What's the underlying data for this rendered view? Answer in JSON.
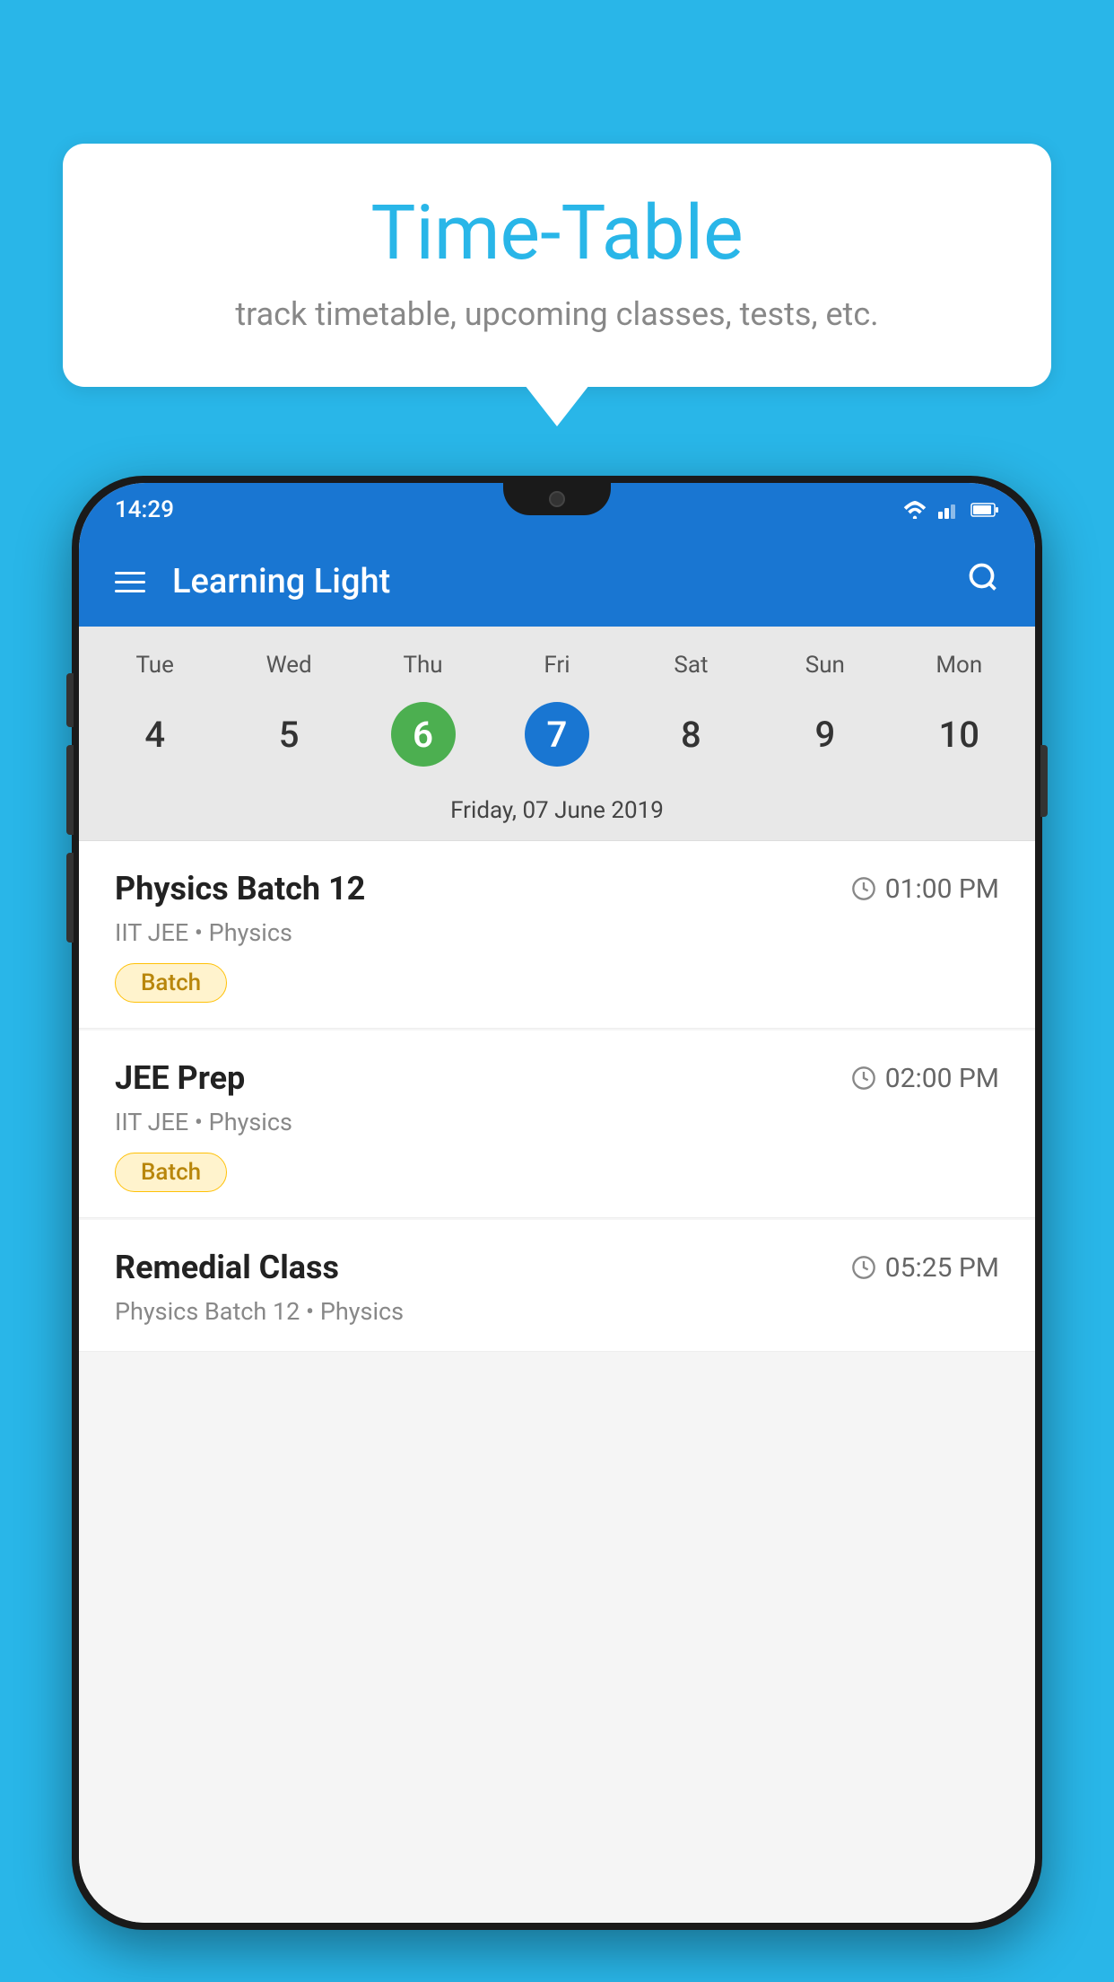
{
  "background": {
    "color": "#29b6e8"
  },
  "bubble": {
    "title": "Time-Table",
    "subtitle": "track timetable, upcoming classes, tests, etc."
  },
  "statusBar": {
    "time": "14:29"
  },
  "appBar": {
    "title": "Learning Light"
  },
  "calendar": {
    "days": [
      {
        "label": "Tue",
        "number": "4"
      },
      {
        "label": "Wed",
        "number": "5"
      },
      {
        "label": "Thu",
        "number": "6",
        "state": "today"
      },
      {
        "label": "Fri",
        "number": "7",
        "state": "selected"
      },
      {
        "label": "Sat",
        "number": "8"
      },
      {
        "label": "Sun",
        "number": "9"
      },
      {
        "label": "Mon",
        "number": "10"
      }
    ],
    "selectedDate": "Friday, 07 June 2019"
  },
  "schedule": [
    {
      "name": "Physics Batch 12",
      "time": "01:00 PM",
      "meta": "IIT JEE • Physics",
      "badge": "Batch"
    },
    {
      "name": "JEE Prep",
      "time": "02:00 PM",
      "meta": "IIT JEE • Physics",
      "badge": "Batch"
    },
    {
      "name": "Remedial Class",
      "time": "05:25 PM",
      "meta": "Physics Batch 12 • Physics",
      "badge": null
    }
  ]
}
